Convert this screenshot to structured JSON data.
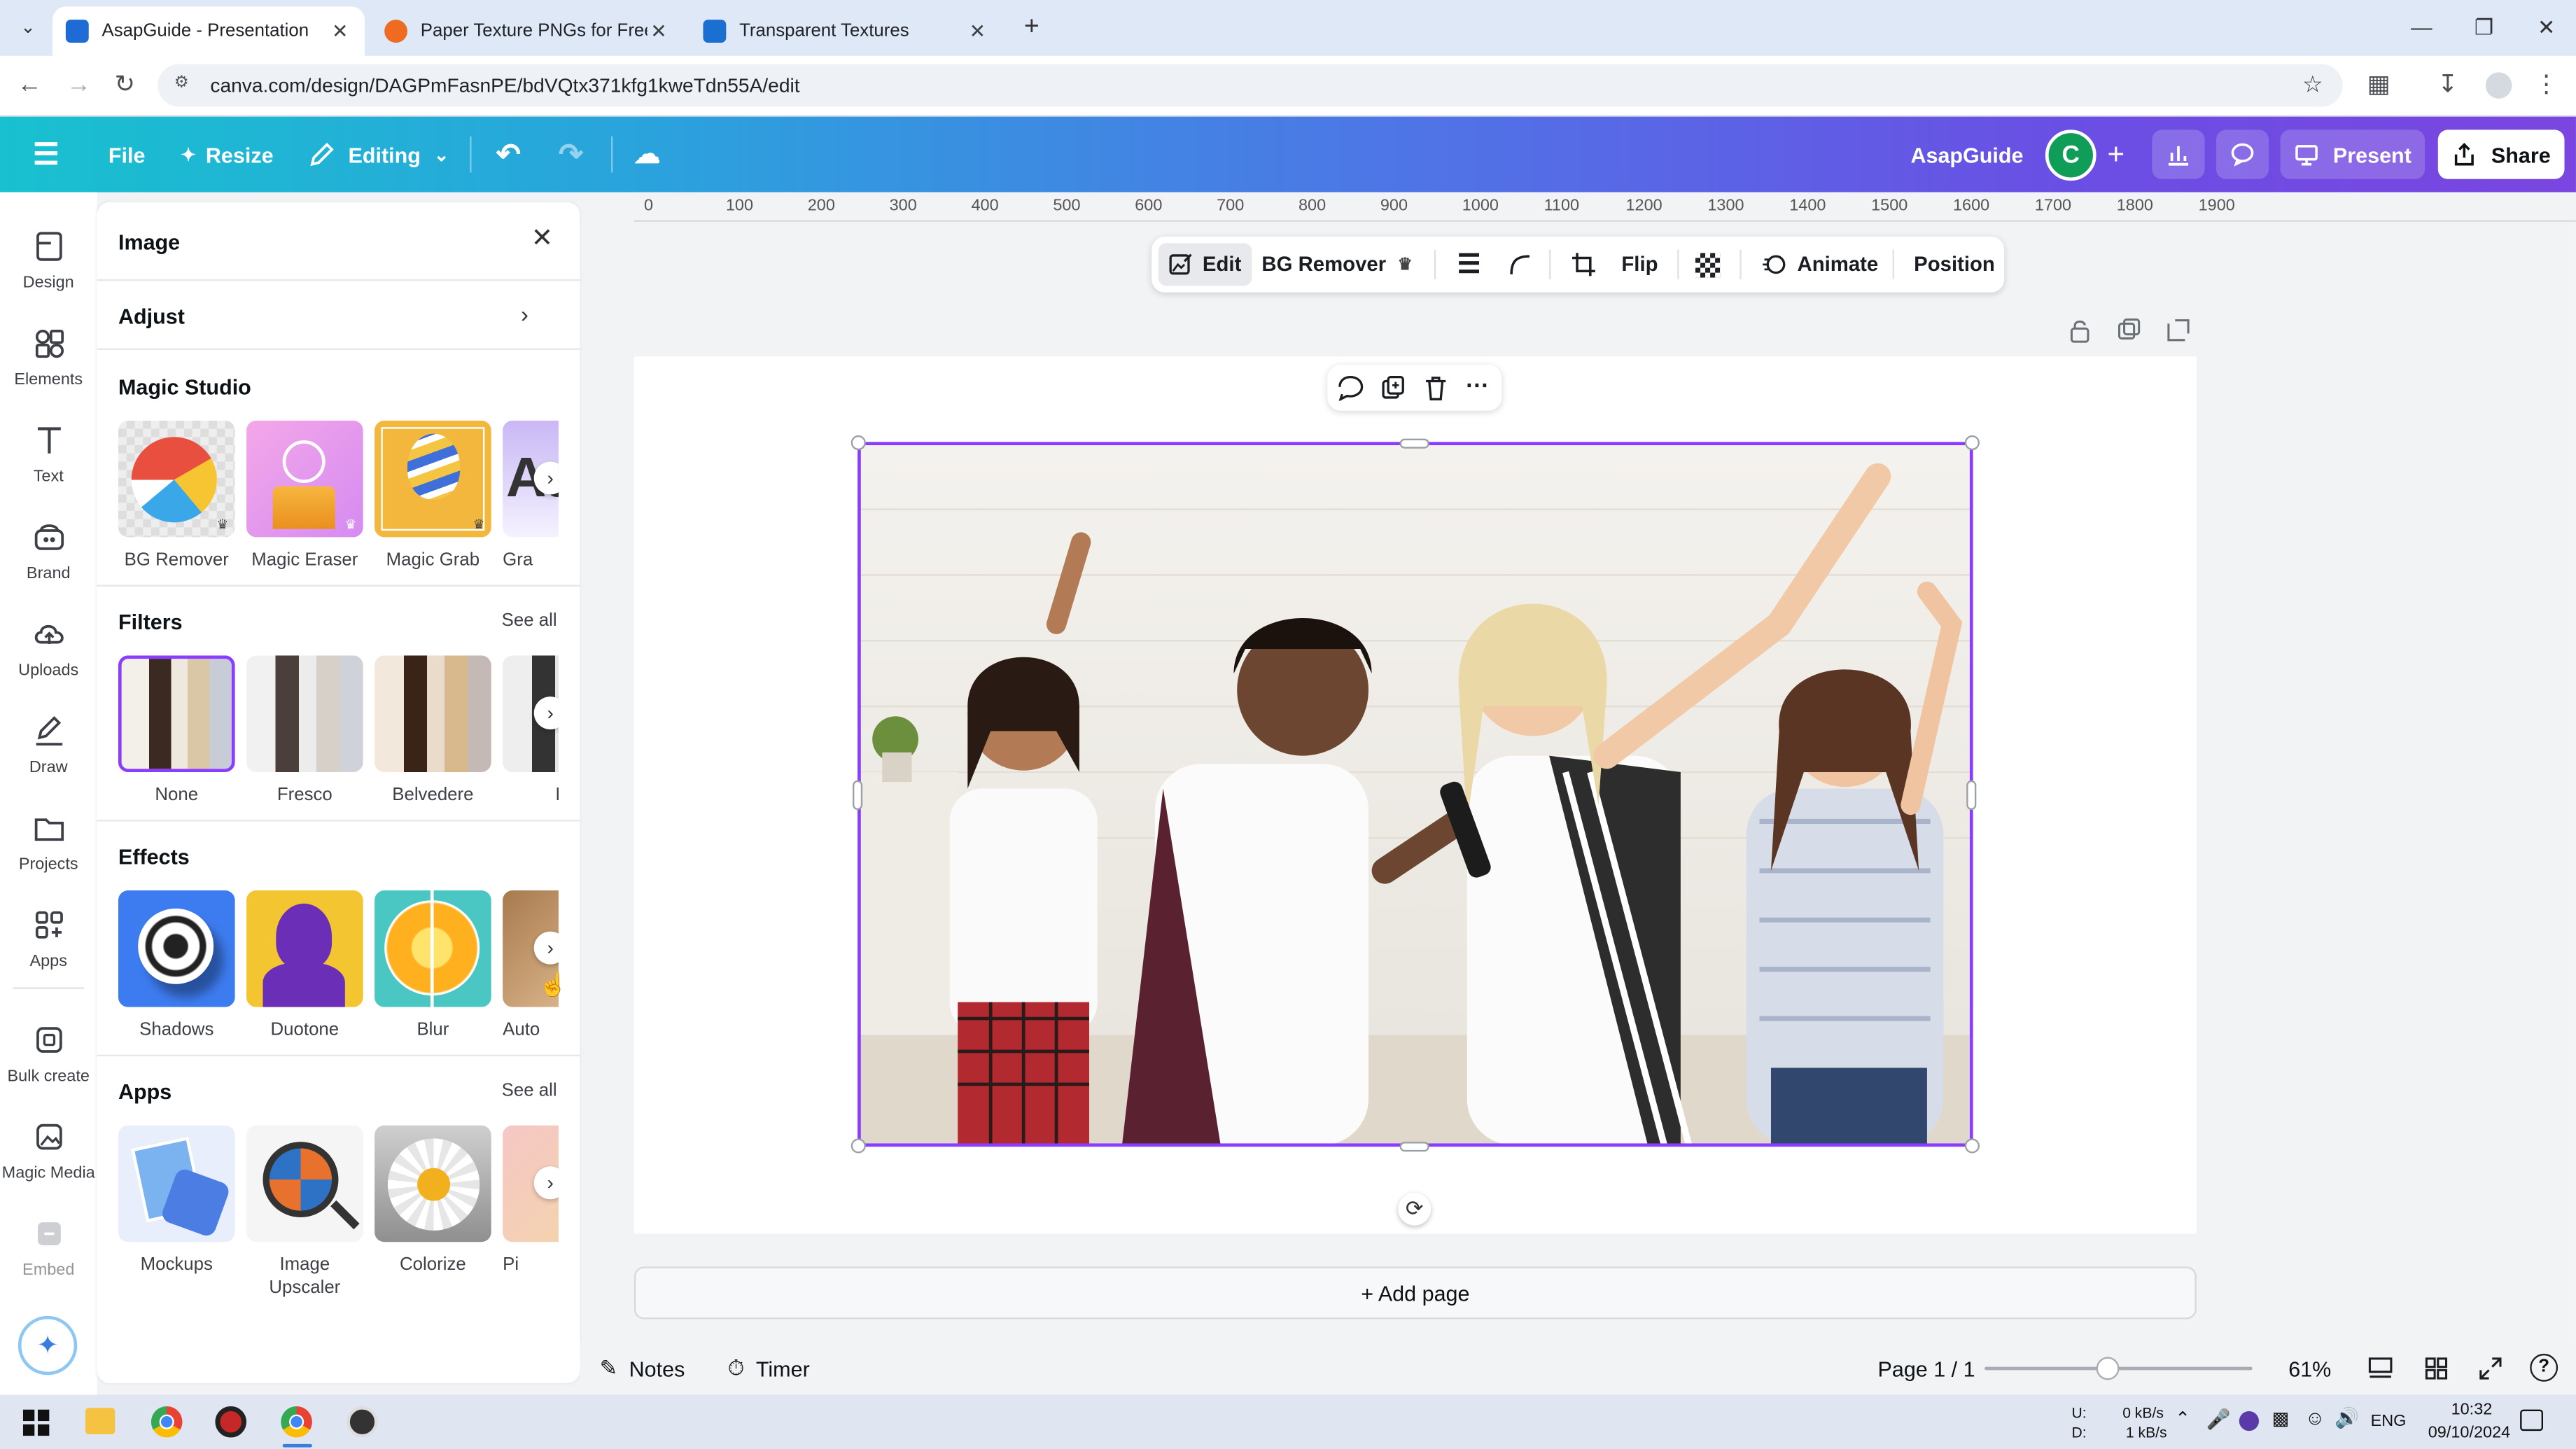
{
  "browser": {
    "tabs": [
      {
        "title": "AsapGuide - Presentation",
        "active": true,
        "icon": "canva-favicon-icon",
        "color": "#1f6bd6"
      },
      {
        "title": "Paper Texture PNGs for Free Do",
        "active": false,
        "icon": "web-favicon-icon",
        "color": "#ef6b22"
      },
      {
        "title": "Transparent Textures",
        "active": false,
        "icon": "tt-favicon-icon",
        "color": "#1b6fd1"
      }
    ],
    "url": "canva.com/design/DAGPmFasnPE/bdVQtx371kfg1kweTdn55A/edit"
  },
  "topbar": {
    "file": "File",
    "resize": "Resize",
    "editing": "Editing",
    "team": "AsapGuide",
    "avatar_letter": "C",
    "present": "Present",
    "share": "Share"
  },
  "rail": {
    "items": [
      {
        "label": "Design",
        "icon": "design-icon"
      },
      {
        "label": "Elements",
        "icon": "elements-icon"
      },
      {
        "label": "Text",
        "icon": "text-icon"
      },
      {
        "label": "Brand",
        "icon": "brand-icon"
      },
      {
        "label": "Uploads",
        "icon": "uploads-icon"
      },
      {
        "label": "Draw",
        "icon": "draw-icon"
      },
      {
        "label": "Projects",
        "icon": "projects-icon"
      },
      {
        "label": "Apps",
        "icon": "apps-icon"
      },
      {
        "label": "Bulk create",
        "icon": "bulk-create-icon"
      },
      {
        "label": "Magic Media",
        "icon": "magic-media-icon"
      },
      {
        "label": "Embed",
        "icon": "embed-icon"
      }
    ]
  },
  "panel": {
    "title": "Image",
    "adjust": "Adjust",
    "magic_studio": {
      "heading": "Magic Studio",
      "items": [
        "BG Remover",
        "Magic Eraser",
        "Magic Grab",
        "Gra"
      ]
    },
    "filters": {
      "heading": "Filters",
      "see_all": "See all",
      "items": [
        "None",
        "Fresco",
        "Belvedere",
        "F"
      ]
    },
    "effects": {
      "heading": "Effects",
      "items": [
        "Shadows",
        "Duotone",
        "Blur",
        "Auto"
      ]
    },
    "apps": {
      "heading": "Apps",
      "see_all": "See all",
      "items": [
        "Mockups",
        "Image Upscaler",
        "Colorize",
        "Pi"
      ]
    }
  },
  "ruler": [
    "0",
    "100",
    "200",
    "300",
    "400",
    "500",
    "600",
    "700",
    "800",
    "900",
    "1000",
    "1100",
    "1200",
    "1300",
    "1400",
    "1500",
    "1600",
    "1700",
    "1800",
    "1900"
  ],
  "context_toolbar": {
    "edit": "Edit",
    "bg_remover": "BG Remover",
    "flip": "Flip",
    "animate": "Animate",
    "position": "Position"
  },
  "canvas": {
    "add_page": "+ Add page"
  },
  "bottombar": {
    "notes": "Notes",
    "timer": "Timer",
    "page": "Page 1 / 1",
    "zoom": "61%",
    "zoom_level": 0.61
  },
  "taskbar": {
    "net_up_label": "U:",
    "net_down_label": "D:",
    "net_up": "0 kB/s",
    "net_down": "1 kB/s",
    "lang": "ENG",
    "time": "10:32",
    "date": "09/10/2024"
  },
  "colors": {
    "accent": "#8b3dff",
    "avatar": "#0f9d58"
  }
}
